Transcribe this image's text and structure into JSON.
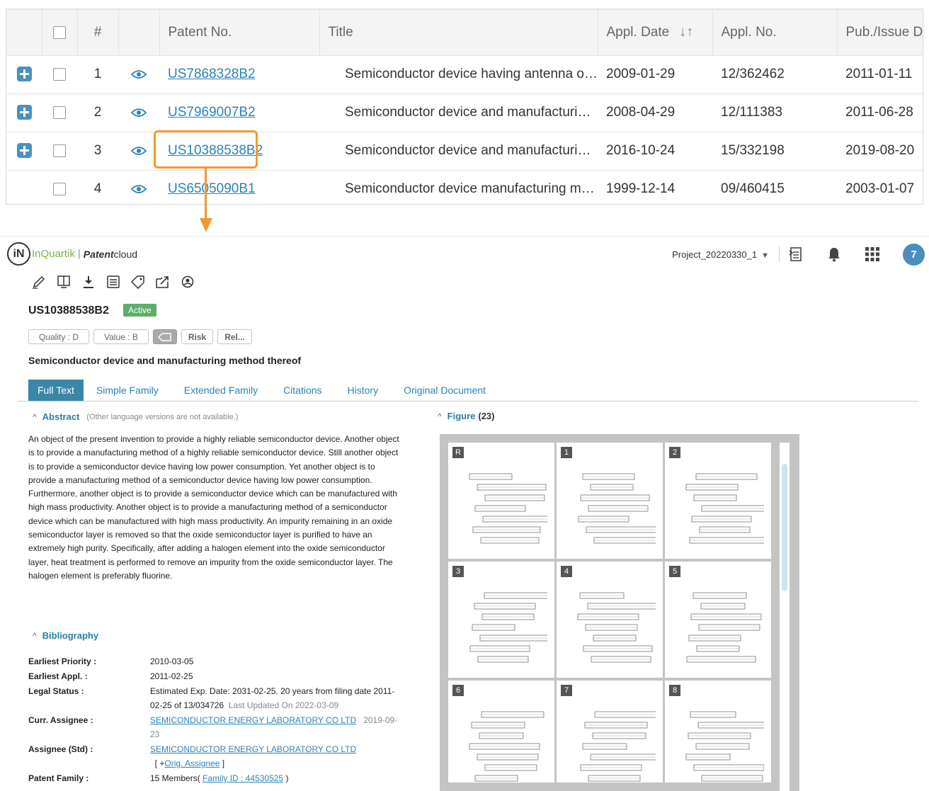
{
  "results_table": {
    "headers": [
      "",
      "",
      "#",
      "",
      "Patent No.",
      "Title",
      "Appl. Date",
      "Appl. No.",
      "Pub./Issue Da"
    ],
    "rows": [
      {
        "num": "1",
        "patent_no": "US7868328B2",
        "title": "Semiconductor device having antenna o…",
        "appl_date": "2009-01-29",
        "appl_no": "12/362462",
        "pub_date": "2011-01-11",
        "expandable": true
      },
      {
        "num": "2",
        "patent_no": "US7969007B2",
        "title": "Semiconductor device and manufacturi…",
        "appl_date": "2008-04-29",
        "appl_no": "12/111383",
        "pub_date": "2011-06-28",
        "expandable": true
      },
      {
        "num": "3",
        "patent_no": "US10388538B2",
        "title": "Semiconductor device and manufacturi…",
        "appl_date": "2016-10-24",
        "appl_no": "15/332198",
        "pub_date": "2019-08-20",
        "expandable": true
      },
      {
        "num": "4",
        "patent_no": "US6505090B1",
        "title": "Semiconductor device manufacturing m…",
        "appl_date": "1999-12-14",
        "appl_no": "09/460415",
        "pub_date": "2003-01-07",
        "expandable": false
      }
    ],
    "highlighted_row": 3,
    "highlight_color": "#f09a2e"
  },
  "brand": {
    "logo_mark": "iN",
    "company": "InQuartik",
    "separator": "|",
    "product_bold": "Patent",
    "product_rest": "cloud"
  },
  "topbar": {
    "project": "Project_20220330_1",
    "notification_count": "7"
  },
  "toolbar_icons": [
    "highlight-pen-icon",
    "split-view-icon",
    "download-icon",
    "list-icon",
    "tag-icon",
    "export-icon",
    "ai-icon"
  ],
  "patent": {
    "number": "US10388538B2",
    "status": "Active",
    "quality": "Quality : D",
    "value": "Value : B",
    "risk": "Risk",
    "rel": "Rel...",
    "title": "Semiconductor device and manufacturing method thereof"
  },
  "tabs": [
    "Full Text",
    "Simple Family",
    "Extended Family",
    "Citations",
    "History",
    "Original Document"
  ],
  "abstract": {
    "heading": "Abstract",
    "note": "(Other language versions are not available.)",
    "text": "An object of the present invention to provide a highly reliable semiconductor device. Another object is to provide a manufacturing method of a highly reliable semiconductor device. Still another object is to provide a semiconductor device having low power consumption. Yet another object is to provide a manufacturing method of a semiconductor device having low power consumption. Furthermore, another object is to provide a semiconductor device which can be manufactured with high mass productivity. Another object is to provide a manufacturing method of a semiconductor device which can be manufactured with high mass productivity. An impurity remaining in an oxide semiconductor layer is removed so that the oxide semiconductor layer is purified to have an extremely high purity. Specifically, after adding a halogen element into the oxide semiconductor layer, heat treatment is performed to remove an impurity from the oxide semiconductor layer. The halogen element is preferably fluorine."
  },
  "bibliography": {
    "heading": "Bibliography",
    "earliest_priority_label": "Earliest Priority :",
    "earliest_priority": "2010-03-05",
    "earliest_appl_label": "Earliest Appl. :",
    "earliest_appl": "2011-02-25",
    "legal_status_label": "Legal Status :",
    "legal_status": "Estimated Exp. Date: 2031-02-25. 20 years from filing date 2011-02-25 of 13/034726",
    "legal_updated": "Last Updated On 2022-03-09",
    "curr_assignee_label": "Curr. Assignee :",
    "curr_assignee": "SEMICONDUCTOR ENERGY LABORATORY CO LTD",
    "curr_assignee_date": "2019-09-23",
    "assignee_std_label": "Assignee (Std) :",
    "assignee_std": "SEMICONDUCTOR ENERGY LABORATORY CO LTD",
    "orig_assignee_prefix": "[ +",
    "orig_assignee_link": "Orig. Assignee",
    "orig_assignee_suffix": " ]",
    "patent_family_label": "Patent Family :",
    "patent_family_prefix": "15 Members(",
    "family_id_link": "Family ID : 44530525",
    "patent_family_suffix": ")"
  },
  "figure": {
    "heading": "Figure",
    "count": "(23)",
    "thumbnails": [
      "R",
      "1",
      "2",
      "3",
      "4",
      "5",
      "6",
      "7",
      "8"
    ]
  }
}
